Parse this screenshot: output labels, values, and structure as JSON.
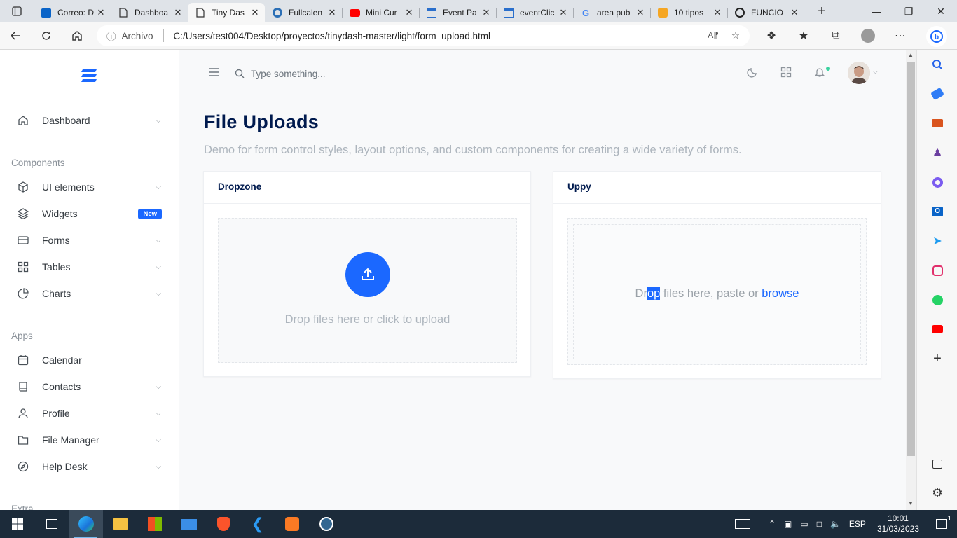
{
  "browser": {
    "tabs": [
      {
        "title": "Correo: D",
        "icon": "outlook-icon",
        "active": false
      },
      {
        "title": "Dashboa",
        "icon": "page-icon",
        "active": false
      },
      {
        "title": "Tiny Das",
        "icon": "page-icon",
        "active": true
      },
      {
        "title": "Fullcalen",
        "icon": "fullcalendar-icon",
        "active": false
      },
      {
        "title": "Mini Cur",
        "icon": "youtube-icon",
        "active": false
      },
      {
        "title": "Event Pa",
        "icon": "calendar-icon",
        "active": false
      },
      {
        "title": "eventClic",
        "icon": "calendar-icon",
        "active": false
      },
      {
        "title": "area pub",
        "icon": "google-icon",
        "active": false
      },
      {
        "title": "10 tipos",
        "icon": "orange-site-icon",
        "active": false
      },
      {
        "title": "FUNCIO",
        "icon": "github-icon",
        "active": false
      }
    ],
    "address": {
      "scheme_label": "Archivo",
      "url": "C:/Users/test004/Desktop/proyectos/tinydash-master/light/form_upload.html"
    }
  },
  "sidebar": {
    "items_top": [
      {
        "label": "Dashboard",
        "icon": "home-icon",
        "chevron": true
      }
    ],
    "section_components": "Components",
    "items_components": [
      {
        "label": "UI elements",
        "icon": "box-icon",
        "chevron": true
      },
      {
        "label": "Widgets",
        "icon": "layers-icon",
        "badge": "New"
      },
      {
        "label": "Forms",
        "icon": "credit-card-icon",
        "chevron": true
      },
      {
        "label": "Tables",
        "icon": "grid-icon",
        "chevron": true
      },
      {
        "label": "Charts",
        "icon": "pie-chart-icon",
        "chevron": true
      }
    ],
    "section_apps": "Apps",
    "items_apps": [
      {
        "label": "Calendar",
        "icon": "calendar-icon",
        "chevron": false
      },
      {
        "label": "Contacts",
        "icon": "book-icon",
        "chevron": true
      },
      {
        "label": "Profile",
        "icon": "user-icon",
        "chevron": true
      },
      {
        "label": "File Manager",
        "icon": "folder-icon",
        "chevron": true
      },
      {
        "label": "Help Desk",
        "icon": "compass-icon",
        "chevron": true
      }
    ],
    "section_extra": "Extra"
  },
  "header": {
    "search_placeholder": "Type something..."
  },
  "main": {
    "title": "File Uploads",
    "subtitle": "Demo for form control styles, layout options, and custom components for creating a wide variety of forms.",
    "dropzone_card": {
      "title": "Dropzone",
      "drop_text": "Drop files here or click to upload"
    },
    "uppy_card": {
      "title": "Uppy",
      "text_before": "Dr",
      "text_selected": "op",
      "text_after": " files here, paste or ",
      "browse": "browse"
    }
  },
  "taskbar": {
    "language": "ESP",
    "time": "10:01",
    "date": "31/03/2023",
    "notifications": "1"
  },
  "colors": {
    "primary": "#1b68ff",
    "title": "#001a4e",
    "muted": "#adb5bd"
  }
}
